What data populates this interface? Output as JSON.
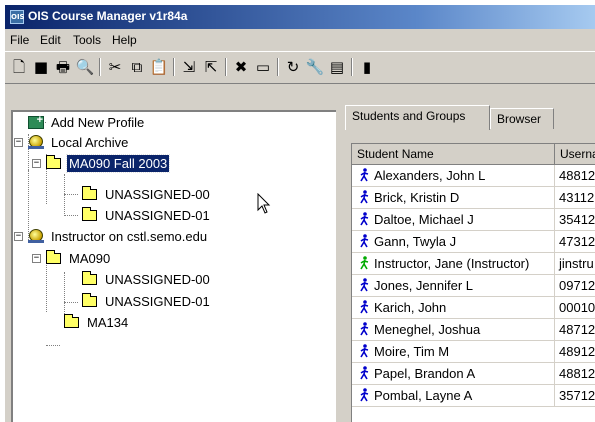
{
  "window": {
    "title": "OIS Course Manager v1r84a",
    "app_icon_text": "OIS"
  },
  "menu": [
    "File",
    "Edit",
    "Tools",
    "Help"
  ],
  "toolbar": {
    "buttons": [
      {
        "icon": "new-document-icon",
        "glyph": "🗋"
      },
      {
        "icon": "stop-square-icon",
        "glyph": "■"
      },
      {
        "icon": "print-icon",
        "glyph": "🖶"
      },
      {
        "icon": "print-preview-icon",
        "glyph": "🔍"
      },
      {
        "icon": "cut-icon",
        "glyph": "✂"
      },
      {
        "icon": "copy-icon",
        "glyph": "⧉"
      },
      {
        "icon": "paste-icon",
        "glyph": "📋"
      },
      {
        "icon": "import-icon",
        "glyph": "⇲"
      },
      {
        "icon": "export-icon",
        "glyph": "⇱"
      },
      {
        "icon": "delete-icon",
        "glyph": "✖"
      },
      {
        "icon": "properties-icon",
        "glyph": "▭"
      },
      {
        "icon": "refresh-icon",
        "glyph": "↻"
      },
      {
        "icon": "tools-icon",
        "glyph": "🔧"
      },
      {
        "icon": "database-icon",
        "glyph": "▤"
      },
      {
        "icon": "exit-door-icon",
        "glyph": "▮"
      }
    ]
  },
  "tree": {
    "items": [
      {
        "label": "Add New Profile",
        "icon": "add-profile-icon"
      },
      {
        "label": "Local Archive",
        "icon": "globe-icon",
        "expander": "−"
      },
      {
        "label": "MA090 Fall 2003",
        "icon": "folder-open-icon",
        "expander": "−",
        "selected": true
      },
      {
        "label": "UNASSIGNED-00",
        "icon": "folder-icon"
      },
      {
        "label": "UNASSIGNED-01",
        "icon": "folder-icon"
      },
      {
        "label": "Instructor on cstl.semo.edu",
        "icon": "globe-icon",
        "expander": "−"
      },
      {
        "label": "MA090",
        "icon": "folder-icon",
        "expander": "−"
      },
      {
        "label": "UNASSIGNED-00",
        "icon": "folder-icon"
      },
      {
        "label": "UNASSIGNED-01",
        "icon": "folder-icon"
      },
      {
        "label": "MA134",
        "icon": "folder-icon"
      }
    ]
  },
  "tabs": [
    {
      "label": "Students and Groups",
      "active": true
    },
    {
      "label": "Browser",
      "active": false
    }
  ],
  "grid": {
    "columns": [
      "Student Name",
      "Userna"
    ],
    "rows": [
      {
        "name": "Alexanders, John L",
        "user": "48812",
        "role": "student"
      },
      {
        "name": "Brick, Kristin D",
        "user": "43112",
        "role": "student"
      },
      {
        "name": "Daltoe, Michael J",
        "user": "35412",
        "role": "student"
      },
      {
        "name": "Gann, Twyla J",
        "user": "47312",
        "role": "student"
      },
      {
        "name": "Instructor, Jane (Instructor)",
        "user": "jinstru",
        "role": "instructor"
      },
      {
        "name": "Jones, Jennifer L",
        "user": "09712",
        "role": "student"
      },
      {
        "name": "Karich, John",
        "user": "00010",
        "role": "student"
      },
      {
        "name": "Meneghel, Joshua",
        "user": "48712",
        "role": "student"
      },
      {
        "name": "Moire, Tim M",
        "user": "48912",
        "role": "student"
      },
      {
        "name": "Papel, Brandon A",
        "user": "48812",
        "role": "student"
      },
      {
        "name": "Pombal, Layne A",
        "user": "35712",
        "role": "student"
      }
    ]
  },
  "colors": {
    "student_icon": "#0000cc",
    "instructor_icon": "#00aa00",
    "selection": "#0a246a"
  }
}
